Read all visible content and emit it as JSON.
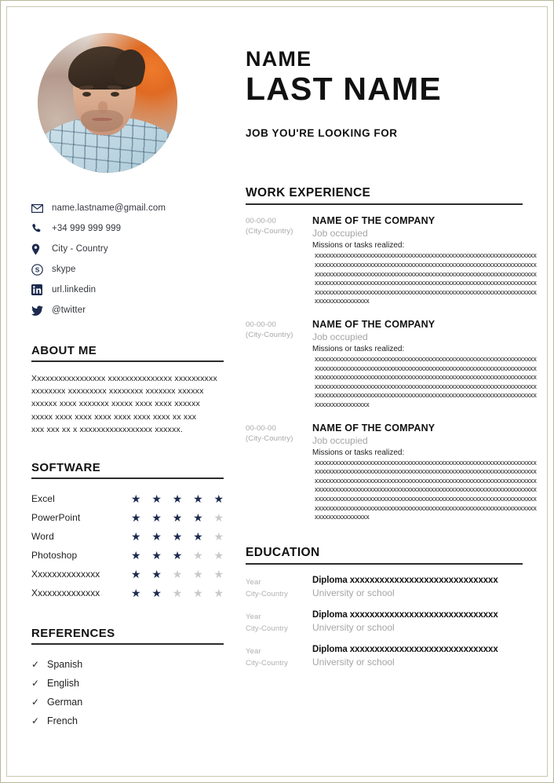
{
  "header": {
    "first_name": "NAME",
    "last_name": "LAST NAME",
    "job_title": "JOB YOU'RE LOOKING FOR",
    "photo_alt": "portrait-photo"
  },
  "contact": {
    "items": [
      {
        "icon": "email-icon",
        "value": "name.lastname@gmail.com"
      },
      {
        "icon": "phone-icon",
        "value": "+34 999 999 999"
      },
      {
        "icon": "location-pin-icon",
        "value": "City - Country"
      },
      {
        "icon": "skype-icon",
        "value": "skype"
      },
      {
        "icon": "linkedin-icon",
        "value": "url.linkedin"
      },
      {
        "icon": "twitter-icon",
        "value": "@twitter"
      }
    ]
  },
  "about": {
    "heading": "ABOUT ME",
    "lines": [
      "Xxxxxxxxxxxxxxxxx xxxxxxxxxxxxxxx xxxxxxxxxx",
      "xxxxxxxx xxxxxxxxx xxxxxxxx xxxxxxx xxxxxx",
      "xxxxxx xxxx xxxxxxx xxxxx xxxx xxxx xxxxxx",
      "xxxxx xxxx xxxx xxxx xxxx xxxx xxxx xx xxx",
      "xxx xxx xx x xxxxxxxxxxxxxxxxx xxxxxx."
    ]
  },
  "software": {
    "heading": "SOFTWARE",
    "max_rating": 5,
    "items": [
      {
        "name": "Excel",
        "rating": 5
      },
      {
        "name": "PowerPoint",
        "rating": 4
      },
      {
        "name": "Word",
        "rating": 4
      },
      {
        "name": "Photoshop",
        "rating": 3
      },
      {
        "name": "Xxxxxxxxxxxxxx",
        "rating": 2
      },
      {
        "name": "Xxxxxxxxxxxxxx",
        "rating": 2
      }
    ],
    "star_filled_color": "#1b2a4e",
    "star_empty_color": "#c9c9c9",
    "star_glyph": "★"
  },
  "references": {
    "heading": "REFERENCES",
    "check_glyph": "✓",
    "items": [
      "Spanish",
      "English",
      "German",
      "French"
    ]
  },
  "work_experience": {
    "heading": "WORK EXPERIENCE",
    "jobs": [
      {
        "date": "00-00-00",
        "location": "(City-Country)",
        "company": "NAME OF THE COMPANY",
        "role": "Job occupied",
        "missions_label": "Missions or tasks realized:",
        "lines": [
          "xxxxxxxxxxxxxxxxxxxxxxxxxxxxxxxxxxxxxxxxxxxxxxxxxxxxxxxxxxxxxxxxx",
          "xxxxxxxxxxxxxxxxxxxxxxxxxxxxxxxxxxxxxxxxxxxxxxxxxxxxxxxxxxxxxxxxx",
          "xxxxxxxxxxxxxxxxxxxxxxxxxxxxxxxxxxxxxxxxxxxxxxxxxxxxxxxxxxxxxxxxx",
          "xxxxxxxxxxxxxxxxxxxxxxxxxxxxxxxxxxxxxxxxxxxxxxxxxxxxxxxxxxxxxxxxx",
          "xxxxxxxxxxxxxxxxxxxxxxxxxxxxxxxxxxxxxxxxxxxxxxxxxxxxxxxxxxxxxxxxx",
          "xxxxxxxxxxxxxxxx"
        ]
      },
      {
        "date": "00-00-00",
        "location": "(City-Country)",
        "company": "NAME OF THE COMPANY",
        "role": "Job occupied",
        "missions_label": "Missions or tasks realized:",
        "lines": [
          "xxxxxxxxxxxxxxxxxxxxxxxxxxxxxxxxxxxxxxxxxxxxxxxxxxxxxxxxxxxxxxxxx",
          "xxxxxxxxxxxxxxxxxxxxxxxxxxxxxxxxxxxxxxxxxxxxxxxxxxxxxxxxxxxxxxxxx",
          "xxxxxxxxxxxxxxxxxxxxxxxxxxxxxxxxxxxxxxxxxxxxxxxxxxxxxxxxxxxxxxxxx",
          "xxxxxxxxxxxxxxxxxxxxxxxxxxxxxxxxxxxxxxxxxxxxxxxxxxxxxxxxxxxxxxxxx",
          "xxxxxxxxxxxxxxxxxxxxxxxxxxxxxxxxxxxxxxxxxxxxxxxxxxxxxxxxxxxxxxxxx",
          "xxxxxxxxxxxxxxxx"
        ]
      },
      {
        "date": "00-00-00",
        "location": "(City-Country)",
        "company": "NAME OF THE COMPANY",
        "role": "Job occupied",
        "missions_label": "Missions or tasks realized:",
        "lines": [
          "xxxxxxxxxxxxxxxxxxxxxxxxxxxxxxxxxxxxxxxxxxxxxxxxxxxxxxxxxxxxxxxxx",
          "xxxxxxxxxxxxxxxxxxxxxxxxxxxxxxxxxxxxxxxxxxxxxxxxxxxxxxxxxxxxxxxxx",
          "xxxxxxxxxxxxxxxxxxxxxxxxxxxxxxxxxxxxxxxxxxxxxxxxxxxxxxxxxxxxxxxxx",
          "xxxxxxxxxxxxxxxxxxxxxxxxxxxxxxxxxxxxxxxxxxxxxxxxxxxxxxxxxxxxxxxxx",
          "xxxxxxxxxxxxxxxxxxxxxxxxxxxxxxxxxxxxxxxxxxxxxxxxxxxxxxxxxxxxxxxxx",
          "xxxxxxxxxxxxxxxxxxxxxxxxxxxxxxxxxxxxxxxxxxxxxxxxxxxxxxxxxxxxxxxxx",
          "xxxxxxxxxxxxxxxx"
        ]
      }
    ]
  },
  "education": {
    "heading": "EDUCATION",
    "entries": [
      {
        "year": "Year",
        "location": "City-Country",
        "diploma": "Diploma xxxxxxxxxxxxxxxxxxxxxxxxxxxxxx",
        "school": "University or school"
      },
      {
        "year": "Year",
        "location": "City-Country",
        "diploma": "Diploma xxxxxxxxxxxxxxxxxxxxxxxxxxxxxx",
        "school": "University or school"
      },
      {
        "year": "Year",
        "location": "City-Country",
        "diploma": "Diploma xxxxxxxxxxxxxxxxxxxxxxxxxxxxxx",
        "school": "University or school"
      }
    ]
  }
}
